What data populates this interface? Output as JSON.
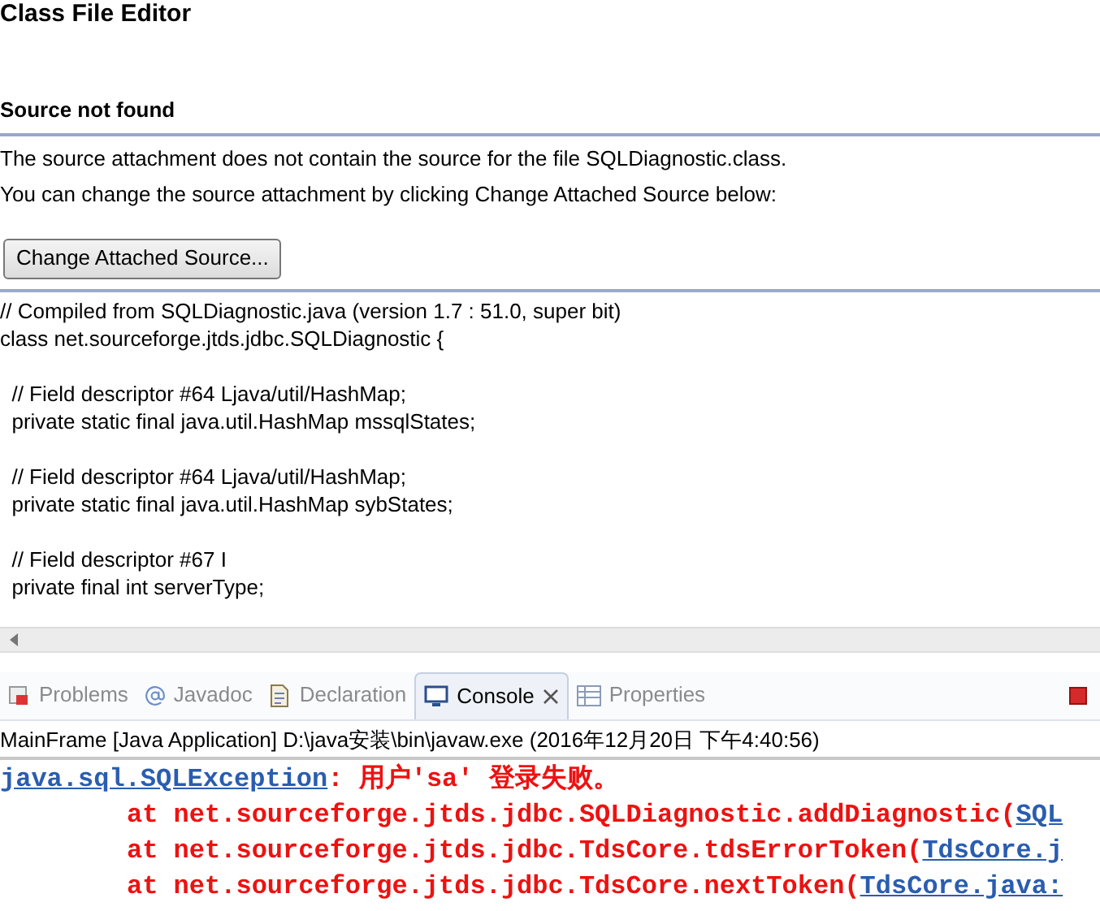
{
  "editor": {
    "title": "Class File Editor",
    "heading": "Source not found",
    "messages": [
      "The source attachment does not contain the source for the file SQLDiagnostic.class.",
      "You can change the source attachment by clicking Change Attached Source below:"
    ],
    "button": "Change Attached Source...",
    "code_blocks": [
      [
        "// Compiled from SQLDiagnostic.java (version 1.7 : 51.0, super bit)",
        "class net.sourceforge.jtds.jdbc.SQLDiagnostic {"
      ],
      [
        "  // Field descriptor #64 Ljava/util/HashMap;",
        "  private static final java.util.HashMap mssqlStates;"
      ],
      [
        "  // Field descriptor #64 Ljava/util/HashMap;",
        "  private static final java.util.HashMap sybStates;"
      ],
      [
        "  // Field descriptor #67 I",
        "  private final int serverType;"
      ]
    ]
  },
  "views": {
    "tabs": [
      {
        "label": "Problems",
        "kind": "problems",
        "selected": false
      },
      {
        "label": "Javadoc",
        "kind": "javadoc",
        "selected": false
      },
      {
        "label": "Declaration",
        "kind": "declaration",
        "selected": false
      },
      {
        "label": "Console",
        "kind": "console",
        "selected": true
      },
      {
        "label": "Properties",
        "kind": "properties",
        "selected": false
      }
    ]
  },
  "console": {
    "header": "MainFrame [Java Application] D:\\java安装\\bin\\javaw.exe (2016年12月20日 下午4:40:56)",
    "lines": [
      {
        "kind": "exception",
        "segments": [
          {
            "kind": "link",
            "text": "java.sql.SQLException"
          },
          {
            "kind": "error",
            "text": ": 用户'sa' 登录失败。"
          }
        ]
      },
      {
        "kind": "frame",
        "segments": [
          {
            "kind": "error",
            "text": "at net.sourceforge.jtds.jdbc.SQLDiagnostic.addDiagnostic("
          },
          {
            "kind": "link",
            "text": "SQL"
          }
        ]
      },
      {
        "kind": "frame",
        "segments": [
          {
            "kind": "error",
            "text": "at net.sourceforge.jtds.jdbc.TdsCore.tdsErrorToken("
          },
          {
            "kind": "link",
            "text": "TdsCore.j"
          }
        ]
      },
      {
        "kind": "frame",
        "segments": [
          {
            "kind": "error",
            "text": "at net.sourceforge.jtds.jdbc.TdsCore.nextToken("
          },
          {
            "kind": "link",
            "text": "TdsCore.java:"
          }
        ]
      }
    ]
  }
}
